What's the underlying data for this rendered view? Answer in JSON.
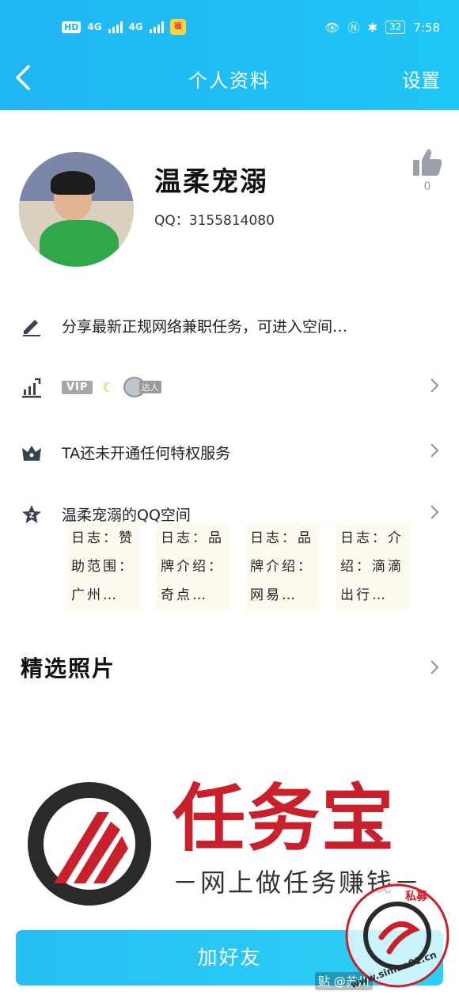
{
  "status_bar": {
    "hd": "HD",
    "net1": "4G",
    "net2": "4G",
    "app_icon": "福",
    "battery": "32",
    "time": "7:58"
  },
  "header": {
    "title": "个人资料",
    "settings": "设置"
  },
  "profile": {
    "name": "温柔宠溺",
    "qq": "QQ：3155814080",
    "likes": "0"
  },
  "rows": {
    "signature": "分享最新正规网络兼职任务，可进入空间…",
    "vip_badge": "VIP",
    "daren_badge": "达人",
    "privilege": "TA还未开通任何特权服务",
    "qzone": "温柔宠溺的QQ空间"
  },
  "blogs": [
    {
      "l1": "日志：赞",
      "l2": "助范围：",
      "l3": "广州…"
    },
    {
      "l1": "日志：品",
      "l2": "牌介绍：",
      "l3": "奇点…"
    },
    {
      "l1": "日志：品",
      "l2": "牌介绍：",
      "l3": "网易…"
    },
    {
      "l1": "日志：介",
      "l2": "绍：滴滴",
      "l3": "出行…"
    }
  ],
  "photos": {
    "title": "精选照片"
  },
  "watermark": {
    "brand": "任务宝",
    "slogan": "－网上做任务赚钱－",
    "stamp_url": "www.simuo01.cn",
    "stamp_text": "私募"
  },
  "footer": {
    "add_friend": "加好友",
    "credit": "贴 @苏州"
  },
  "colors": {
    "header": "#21b6f5",
    "button": "#2ac6f5",
    "brand_red": "#c9202b"
  }
}
